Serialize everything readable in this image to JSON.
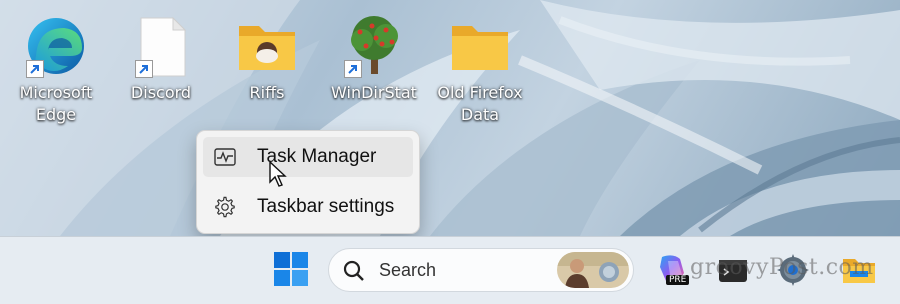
{
  "desktop": {
    "icons": [
      {
        "label": "Microsoft Edge",
        "icon": "edge-icon",
        "shortcut": true
      },
      {
        "label": "Discord",
        "icon": "blank-file-icon",
        "shortcut": true
      },
      {
        "label": "Riffs",
        "icon": "folder-icon",
        "shortcut": false
      },
      {
        "label": "WinDirStat",
        "icon": "tree-icon",
        "shortcut": true
      },
      {
        "label": "Old Firefox Data",
        "icon": "folder-icon",
        "shortcut": false
      }
    ]
  },
  "context_menu": {
    "items": [
      {
        "label": "Task Manager",
        "icon": "activity-monitor-icon",
        "hovered": true
      },
      {
        "label": "Taskbar settings",
        "icon": "gear-icon",
        "hovered": false
      }
    ]
  },
  "taskbar": {
    "search_label": "Search",
    "watermark": "groovyPost.com",
    "copilot_badge": "PRE",
    "apps": [
      "windows-start-icon",
      "copilot-icon",
      "terminal-icon",
      "settings-gear-icon",
      "file-explorer-icon"
    ]
  },
  "colors": {
    "accent": "#0067c0",
    "folder": "#f8c846",
    "menu_bg": "#f3f3f3"
  }
}
